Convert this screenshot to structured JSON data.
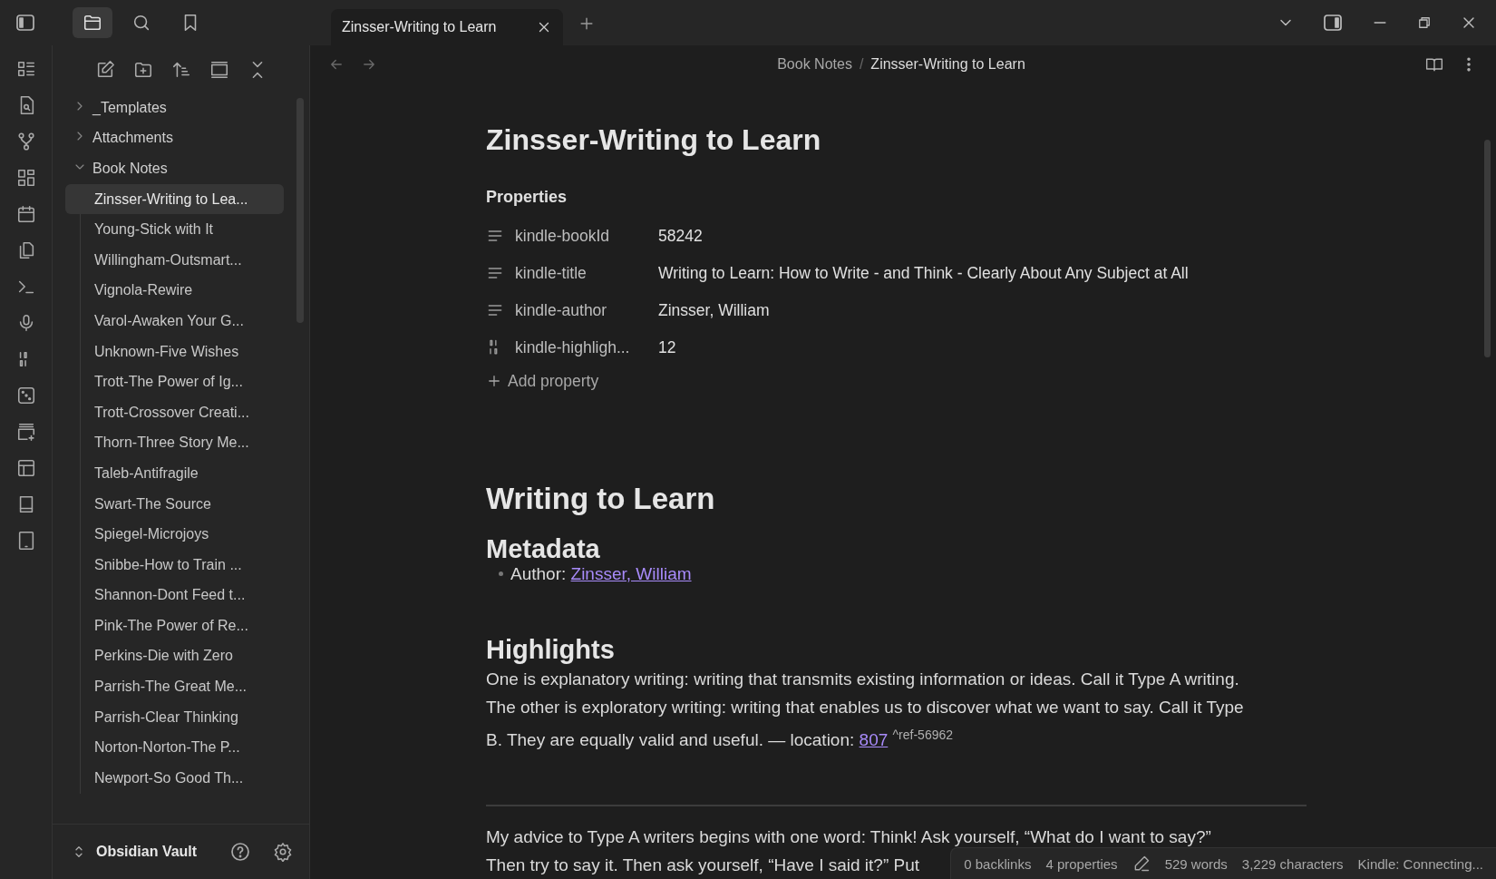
{
  "tabs": [
    {
      "title": "Zinsser-Writing to Learn",
      "selected": true
    }
  ],
  "sidebar_tabs": [
    {
      "kind": "files",
      "selected": true
    },
    {
      "kind": "search",
      "selected": false
    },
    {
      "kind": "bookmarks",
      "selected": false
    }
  ],
  "file_tree": [
    {
      "name": "_Templates",
      "kind": "folder",
      "expanded": false,
      "selected": false
    },
    {
      "name": "Attachments",
      "kind": "folder",
      "expanded": false,
      "selected": false
    },
    {
      "name": "Book Notes",
      "kind": "folder",
      "expanded": true,
      "selected": false,
      "children": [
        {
          "name": "Zinsser-Writing to Lea...",
          "selected": true
        },
        {
          "name": "Young-Stick with It",
          "selected": false
        },
        {
          "name": "Willingham-Outsmart...",
          "selected": false
        },
        {
          "name": "Vignola-Rewire",
          "selected": false
        },
        {
          "name": "Varol-Awaken Your G...",
          "selected": false
        },
        {
          "name": "Unknown-Five Wishes",
          "selected": false
        },
        {
          "name": "Trott-The Power of Ig...",
          "selected": false
        },
        {
          "name": "Trott-Crossover Creati...",
          "selected": false
        },
        {
          "name": "Thorn-Three Story Me...",
          "selected": false
        },
        {
          "name": "Taleb-Antifragile",
          "selected": false
        },
        {
          "name": "Swart-The Source",
          "selected": false
        },
        {
          "name": "Spiegel-Microjoys",
          "selected": false
        },
        {
          "name": "Snibbe-How to Train ...",
          "selected": false
        },
        {
          "name": "Shannon-Dont Feed t...",
          "selected": false
        },
        {
          "name": "Pink-The Power of Re...",
          "selected": false
        },
        {
          "name": "Perkins-Die with Zero",
          "selected": false
        },
        {
          "name": "Parrish-The Great Me...",
          "selected": false
        },
        {
          "name": "Parrish-Clear Thinking",
          "selected": false
        },
        {
          "name": "Norton-Norton-The P...",
          "selected": false
        },
        {
          "name": "Newport-So Good Th...",
          "selected": false
        }
      ]
    }
  ],
  "vault": {
    "name": "Obsidian Vault"
  },
  "breadcrumb": [
    "Book Notes",
    "Zinsser-Writing to Learn"
  ],
  "breadcrumb_separator": "/",
  "note": {
    "title": "Zinsser-Writing to Learn",
    "properties_heading": "Properties",
    "properties": [
      {
        "kind": "text",
        "key": "kindle-bookId",
        "value": "58242"
      },
      {
        "kind": "text",
        "key": "kindle-title",
        "value": "Writing to Learn: How to Write - and Think - Clearly About Any Subject at All"
      },
      {
        "kind": "text",
        "key": "kindle-author",
        "value": "Zinsser, William"
      },
      {
        "kind": "number",
        "key": "kindle-highligh...",
        "value": "12"
      }
    ],
    "add_property": "Add property",
    "h1": "Writing to Learn",
    "metadata_heading": "Metadata",
    "author_label": "Author: ",
    "author_link": "Zinsser, William",
    "highlights_heading": "Highlights",
    "highlight_text": "One is explanatory writing: writing that transmits existing information or ideas. Call it Type A writing. The other is exploratory writing: writing that enables us to discover what we want to say. Call it Type B. They are equally valid and useful. — location: ",
    "location_link": "807",
    "ref": "^ref-56962",
    "next_lines": [
      "My advice to Type A writers begins with one word: Think! Ask yourself, “What do I want to say?”",
      "Then try to say it. Then ask yourself, “Have I said it?” Put"
    ]
  },
  "status_bar": {
    "backlinks": "0 backlinks",
    "properties": "4 properties",
    "words": "529 words",
    "characters": "3,229 characters",
    "plugin": "Kindle: Connecting..."
  }
}
